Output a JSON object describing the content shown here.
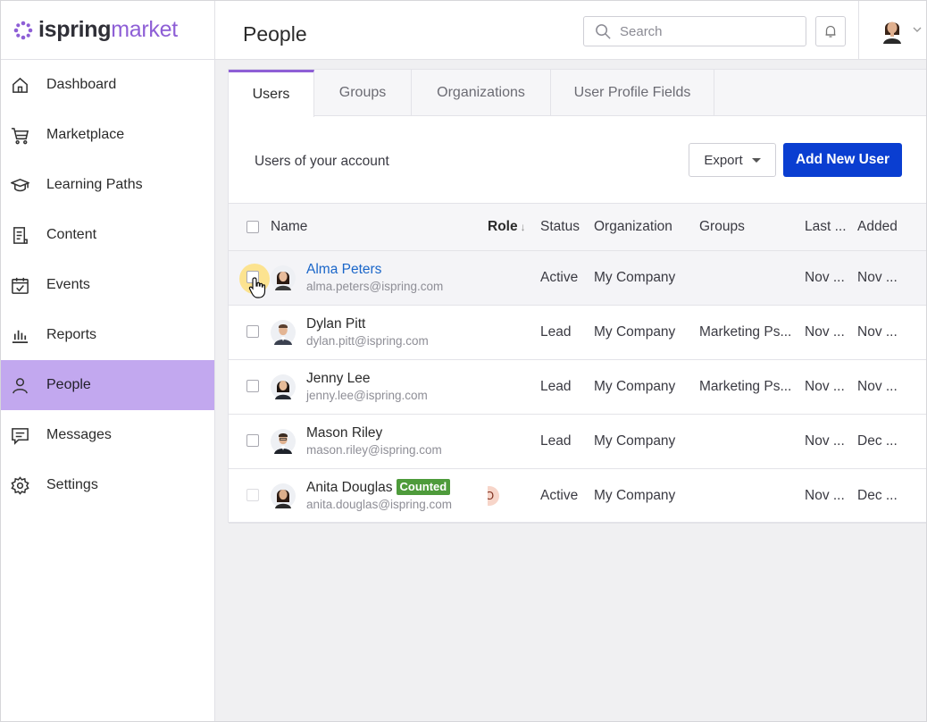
{
  "app": {
    "brand_a": "ispring",
    "brand_b": "market"
  },
  "sidebar": {
    "items": [
      {
        "label": "Dashboard",
        "icon": "home-icon"
      },
      {
        "label": "Marketplace",
        "icon": "cart-icon"
      },
      {
        "label": "Learning Paths",
        "icon": "graduation-cap-icon"
      },
      {
        "label": "Content",
        "icon": "document-icon"
      },
      {
        "label": "Events",
        "icon": "calendar-check-icon"
      },
      {
        "label": "Reports",
        "icon": "bar-chart-icon"
      },
      {
        "label": "People",
        "icon": "person-icon",
        "active": true
      },
      {
        "label": "Messages",
        "icon": "message-icon"
      },
      {
        "label": "Settings",
        "icon": "gear-icon"
      }
    ]
  },
  "header": {
    "title": "People",
    "search_placeholder": "Search"
  },
  "tabs": [
    {
      "label": "Users",
      "active": true
    },
    {
      "label": "Groups"
    },
    {
      "label": "Organizations"
    },
    {
      "label": "User Profile Fields"
    }
  ],
  "toolbar": {
    "subtitle": "Users of your account",
    "export_label": "Export",
    "add_label": "Add New User"
  },
  "table": {
    "columns": {
      "name": "Name",
      "role": "Role",
      "role_sort": "↓",
      "status": "Status",
      "organization": "Organization",
      "groups": "Groups",
      "last": "Last ...",
      "added": "Added"
    },
    "rows": [
      {
        "name": "Alma Peters",
        "email": "alma.peters@ispring.com",
        "role": "",
        "status": "Active",
        "organization": "My Company",
        "groups": "",
        "last": "Nov ...",
        "added": "Nov ..."
      },
      {
        "name": "Dylan Pitt",
        "email": "dylan.pitt@ispring.com",
        "role": "",
        "status": "Lead",
        "organization": "My Company",
        "groups": "Marketing Ps...",
        "last": "Nov ...",
        "added": "Nov ..."
      },
      {
        "name": "Jenny Lee",
        "email": "jenny.lee@ispring.com",
        "role": "",
        "status": "Lead",
        "organization": "My Company",
        "groups": "Marketing Ps...",
        "last": "Nov ...",
        "added": "Nov ..."
      },
      {
        "name": "Mason Riley",
        "email": "mason.riley@ispring.com",
        "role": "",
        "status": "Lead",
        "organization": "My Company",
        "groups": "",
        "last": "Nov ...",
        "added": "Dec ..."
      },
      {
        "name": "Anita Douglas",
        "email": "anita.douglas@ispring.com",
        "badge": "Counted",
        "role": "O",
        "status": "Active",
        "organization": "My Company",
        "groups": "",
        "last": "Nov ...",
        "added": "Dec ..."
      }
    ]
  },
  "colors": {
    "accent": "#8e5fd6",
    "active_nav": "#c2a8ef",
    "primary_button": "#0a3ed1",
    "link": "#1a66c9",
    "badge": "#4e9b3b"
  }
}
